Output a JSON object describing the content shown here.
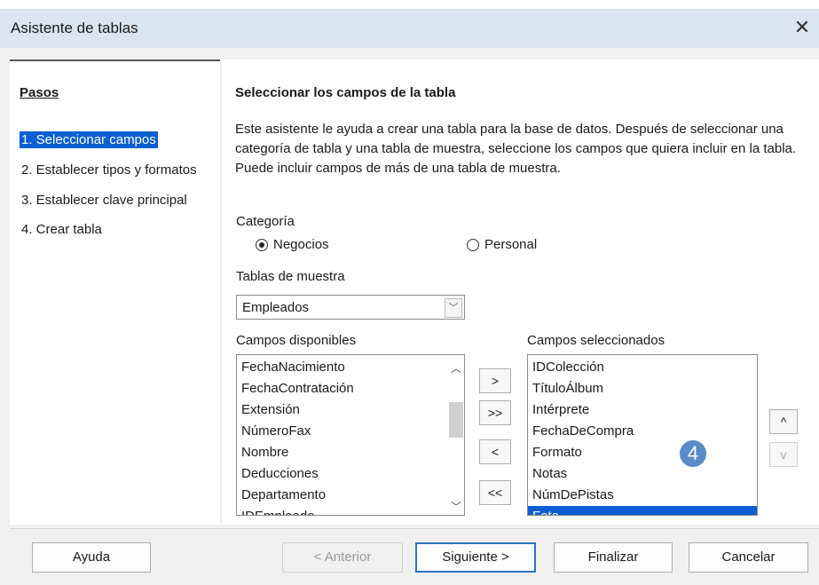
{
  "window": {
    "title": "Asistente de tablas",
    "close_glyph": "✕"
  },
  "steps": {
    "heading": "Pasos",
    "items": [
      {
        "label": "1. Seleccionar campos",
        "selected": true
      },
      {
        "label": "2. Establecer tipos y formatos",
        "selected": false
      },
      {
        "label": "3. Establecer clave principal",
        "selected": false
      },
      {
        "label": "4. Crear tabla",
        "selected": false
      }
    ]
  },
  "main": {
    "title": "Seleccionar los campos de la tabla",
    "description": "Este asistente le ayuda a crear una tabla para la base de datos. Después de seleccionar una categoría de tabla y una tabla de muestra, seleccione los campos que quiera incluir en la tabla. Puede incluir campos de más de una tabla de muestra.",
    "category_label": "Categoría",
    "category_options": [
      {
        "label": "Negocios",
        "checked": true
      },
      {
        "label": "Personal",
        "checked": false
      }
    ],
    "sample_tables_label": "Tablas de muestra",
    "sample_table_value": "Empleados",
    "available_label": "Campos disponibles",
    "available_fields": [
      "FechaNacimiento",
      "FechaContratación",
      "Extensión",
      "NúmeroFax",
      "Nombre",
      "Deducciones",
      "Departamento",
      "IDEmpleado"
    ],
    "selected_label": "Campos seleccionados",
    "selected_fields": [
      "IDColección",
      "TítuloÁlbum",
      "Intérprete",
      "FechaDeCompra",
      "Formato",
      "Notas",
      "NúmDePistas",
      "Foto"
    ],
    "highlighted_selected": "Foto",
    "transfer_buttons": {
      "add": ">",
      "add_all": ">>",
      "remove": "<",
      "remove_all": "<<"
    },
    "order_buttons": {
      "up": "^",
      "down": "v"
    },
    "callout_number": "4"
  },
  "footer": {
    "help": "Ayuda",
    "previous": "< Anterior",
    "next": "Siguiente >",
    "finish": "Finalizar",
    "cancel": "Cancelar"
  },
  "colors": {
    "selection": "#0b5fd0",
    "titlebar": "#dae5f2",
    "callout": "#5b8bc9"
  }
}
